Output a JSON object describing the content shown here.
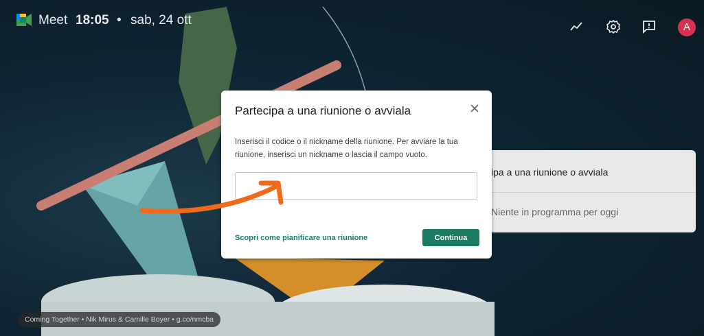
{
  "topbar": {
    "app_name": "Meet",
    "time": "18:05",
    "separator": "•",
    "date": "sab, 24 ott",
    "avatar_letter": "A"
  },
  "dialog": {
    "title": "Partecipa a una riunione o avviala",
    "description": "Inserisci il codice o il nickname della riunione. Per avviare la tua riunione, inserisci un nickname o lascia il campo vuoto.",
    "input_value": "",
    "link_label": "Scopri come pianificare una riunione",
    "continue_label": "Continua"
  },
  "panel": {
    "join_label": "ipa a una riunione o avviala",
    "empty_label": "Niente in programma per oggi"
  },
  "credit": "Coming Together  •  Nik Mirus & Camille Boyer  •  g.co/nmcba",
  "colors": {
    "accent": "#1a7a62",
    "link": "#138070",
    "avatar": "#d93251",
    "arrow": "#f06a1c"
  }
}
